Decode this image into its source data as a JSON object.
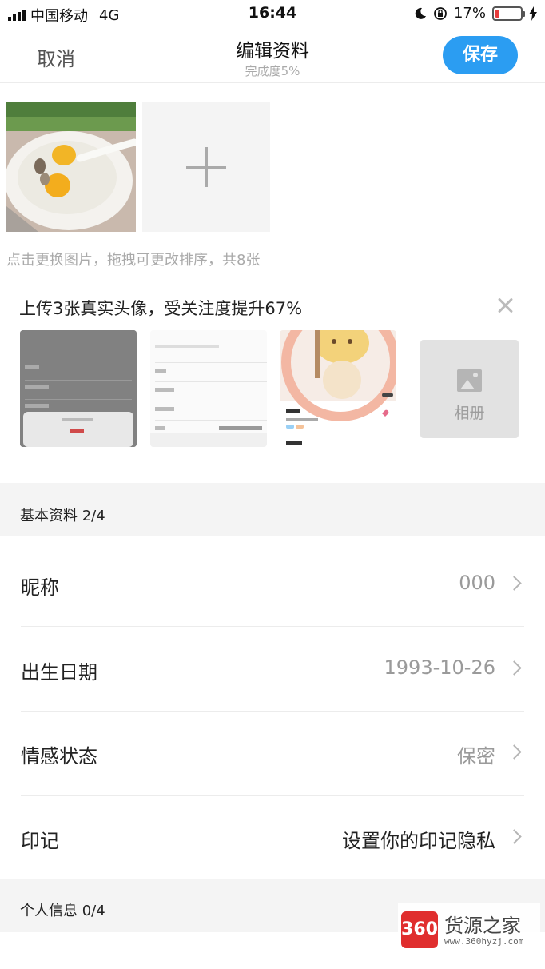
{
  "status_bar": {
    "carrier": "中国移动",
    "network": "4G",
    "time": "16:44",
    "battery_percent": "17%",
    "battery_level": 0.17
  },
  "nav": {
    "cancel_label": "取消",
    "title": "编辑资料",
    "subtitle": "完成度5%",
    "save_label": "保存"
  },
  "photos": {
    "hint": "点击更换图片，拖拽可更改排序，共8张"
  },
  "upload_tip": {
    "title": "上传3张真实头像，受关注度提升67%",
    "album_label": "相册"
  },
  "basic_info": {
    "header": "基本资料  2/4",
    "rows": [
      {
        "label": "昵称",
        "value": "000"
      },
      {
        "label": "出生日期",
        "value": "1993-10-26"
      },
      {
        "label": "情感状态",
        "value": "保密"
      },
      {
        "label": "印记",
        "value": "设置你的印记隐私"
      }
    ]
  },
  "personal_info": {
    "header": "个人信息  0/4"
  },
  "watermark": {
    "badge": "360",
    "name": "货源之家",
    "url": "www.360hyzj.com"
  },
  "colors": {
    "accent": "#2b9df2",
    "section_bg": "#f4f4f4",
    "battery_low": "#e63a3a"
  }
}
